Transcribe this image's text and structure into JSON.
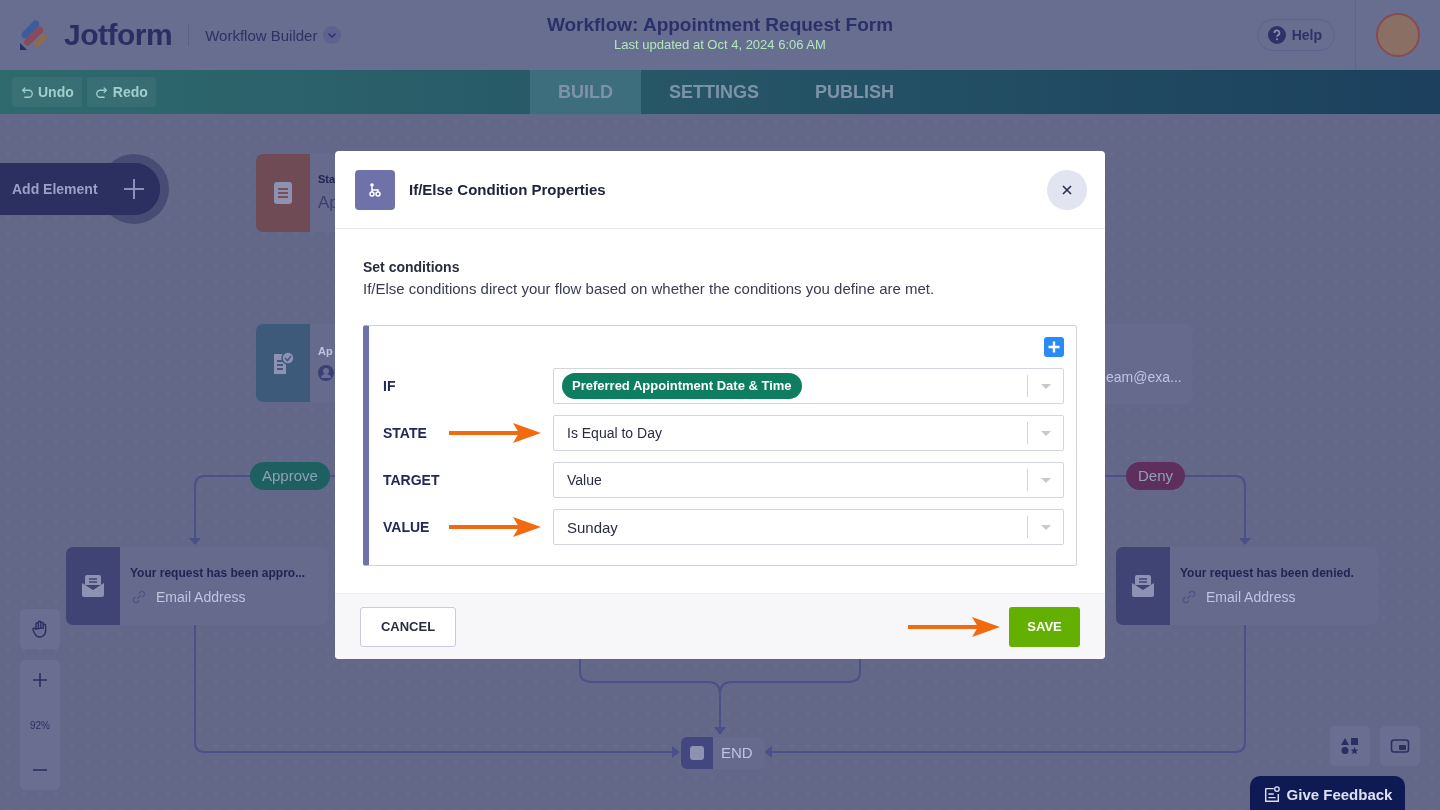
{
  "header": {
    "logo": "Jotform",
    "product": "Workflow Builder",
    "title": "Workflow: Appointment Request Form",
    "subtitle": "Last updated at Oct 4, 2024 6:06 AM",
    "help": "Help"
  },
  "toolbar": {
    "actions": [
      {
        "label": "Undo",
        "kind": "undo",
        "disabled": true
      },
      {
        "label": "Redo",
        "kind": "redo",
        "disabled": true
      }
    ],
    "tabs": [
      {
        "label": "BUILD",
        "selected": true
      },
      {
        "label": "SETTINGS",
        "selected": false
      },
      {
        "label": "PUBLISH",
        "selected": false
      }
    ]
  },
  "canvas": {
    "add_element": "Add Element",
    "nodes": [
      {
        "kind": "start",
        "title": "Sta",
        "text": "Ap"
      },
      {
        "kind": "approval",
        "title": "Ap"
      },
      {
        "kind": "partial",
        "text": "eam@exa..."
      },
      {
        "kind": "email",
        "title": "Your request has been appro...",
        "text": "Email Address"
      },
      {
        "kind": "email",
        "title": "Your request has been denied.",
        "text": "Email Address"
      }
    ],
    "branch_labels": [
      {
        "label": "Approve",
        "color": "#1e5f62"
      },
      {
        "label": "Deny",
        "color": "#5e2f5c"
      }
    ],
    "end": "END",
    "zoom": "92%"
  },
  "dialog": {
    "title": "If/Else Condition Properties",
    "heading": "Set conditions",
    "description": "If/Else conditions direct your flow based on whether the conditions you define are met.",
    "conditions": [
      {
        "label": "IF",
        "kind": "tag",
        "value": "Preferred Appointment Date & Time",
        "annotated": false
      },
      {
        "label": "STATE",
        "kind": "select",
        "value": "Is Equal to Day",
        "annotated": true
      },
      {
        "label": "TARGET",
        "kind": "select",
        "value": "Value",
        "annotated": false
      },
      {
        "label": "VALUE",
        "kind": "input",
        "value": "Sunday",
        "annotated": true
      }
    ],
    "cancel": "CANCEL",
    "save": {
      "label": "SAVE",
      "annotated": true
    }
  },
  "feedback": "Give Feedback"
}
